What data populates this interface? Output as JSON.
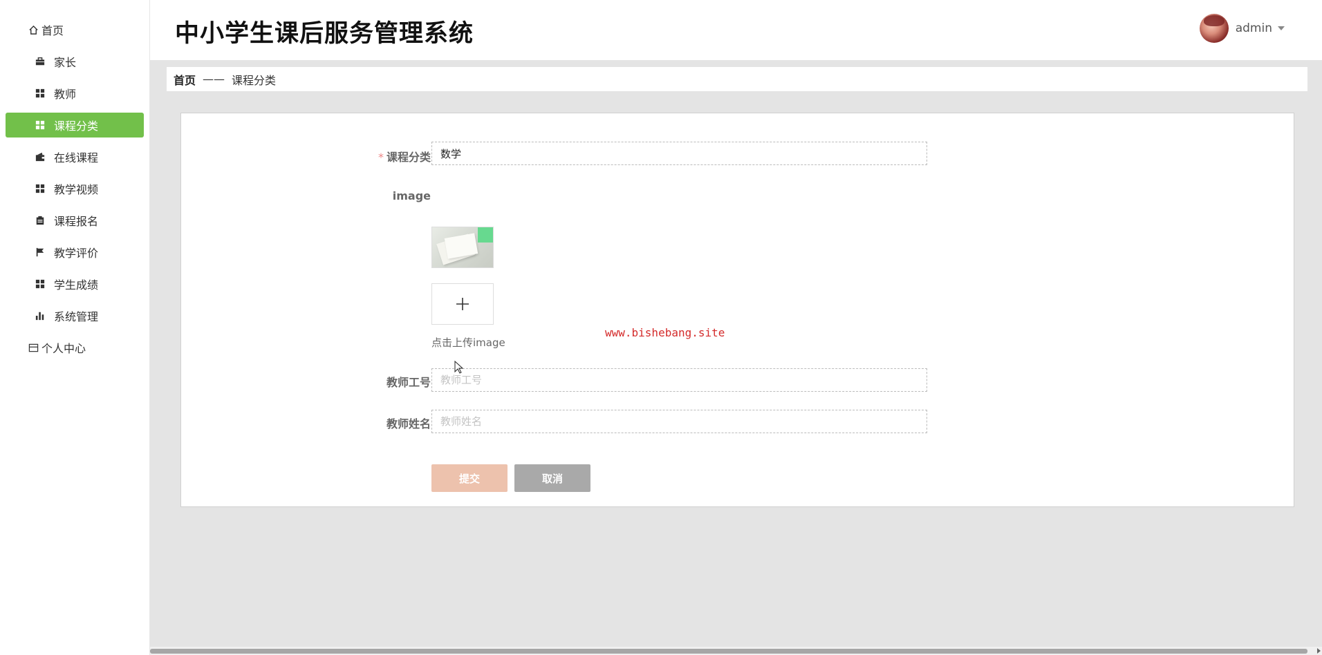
{
  "app": {
    "title": "中小学生课后服务管理系统"
  },
  "user": {
    "name": "admin"
  },
  "sidebar": {
    "items": [
      {
        "label": "首页",
        "icon": "home-icon",
        "level": "top"
      },
      {
        "label": "家长",
        "icon": "briefcase-icon",
        "level": "sub"
      },
      {
        "label": "教师",
        "icon": "grid-icon",
        "level": "sub"
      },
      {
        "label": "课程分类",
        "icon": "grid-icon",
        "level": "sub",
        "active": true
      },
      {
        "label": "在线课程",
        "icon": "wallet-icon",
        "level": "sub"
      },
      {
        "label": "教学视频",
        "icon": "grid-icon",
        "level": "sub"
      },
      {
        "label": "课程报名",
        "icon": "clipboard-icon",
        "level": "sub"
      },
      {
        "label": "教学评价",
        "icon": "flag-icon",
        "level": "sub"
      },
      {
        "label": "学生成绩",
        "icon": "grid-icon",
        "level": "sub"
      },
      {
        "label": "系统管理",
        "icon": "bar-chart-icon",
        "level": "sub"
      },
      {
        "label": "个人中心",
        "icon": "card-icon",
        "level": "top"
      }
    ]
  },
  "breadcrumb": {
    "home": "首页",
    "separator": "——",
    "current": "课程分类"
  },
  "form": {
    "category": {
      "label": "课程分类",
      "required_mark": "*",
      "value": "数学"
    },
    "image": {
      "label": "image",
      "upload_hint": "点击上传image"
    },
    "teacher_id": {
      "label": "教师工号",
      "placeholder": "教师工号",
      "value": ""
    },
    "teacher_name": {
      "label": "教师姓名",
      "placeholder": "教师姓名",
      "value": ""
    },
    "submit_label": "提交",
    "cancel_label": "取消"
  },
  "watermark": "www.bishebang.site",
  "colors": {
    "accent": "#72c04a",
    "submit": "#edc2ad",
    "cancel": "#a9a9a9",
    "watermark": "#d42b2b"
  }
}
